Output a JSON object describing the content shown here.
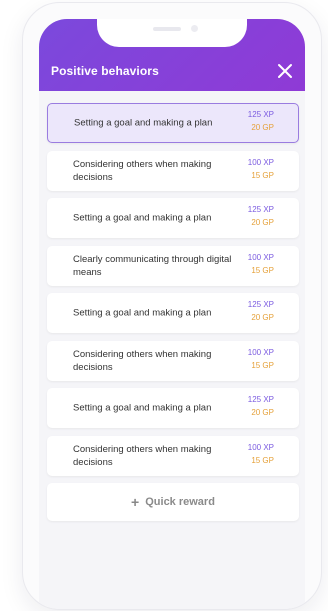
{
  "header": {
    "title": "Positive behaviors",
    "close_icon": "close-icon",
    "accent_color": "#7b49dc"
  },
  "behaviors": [
    {
      "label": "Setting a goal and making a plan",
      "xp": "125 XP",
      "gp": "20 GP",
      "selected": true
    },
    {
      "label": "Considering others when making decisions",
      "xp": "100 XP",
      "gp": "15 GP",
      "selected": false
    },
    {
      "label": "Setting a goal and making a plan",
      "xp": "125 XP",
      "gp": "20 GP",
      "selected": false
    },
    {
      "label": "Clearly communicating through digital means",
      "xp": "100 XP",
      "gp": "15 GP",
      "selected": false
    },
    {
      "label": "Setting a goal and making a plan",
      "xp": "125 XP",
      "gp": "20 GP",
      "selected": false
    },
    {
      "label": "Considering others when making decisions",
      "xp": "100 XP",
      "gp": "15 GP",
      "selected": false
    },
    {
      "label": "Setting a goal and making a plan",
      "xp": "125 XP",
      "gp": "20 GP",
      "selected": false
    },
    {
      "label": "Considering others when making decisions",
      "xp": "100 XP",
      "gp": "15 GP",
      "selected": false
    }
  ],
  "quick_reward": {
    "icon": "plus-icon",
    "label": "Quick reward"
  },
  "colors": {
    "xp": "#7b5be0",
    "gp": "#e5a13a",
    "selected_bg": "#ece7fb"
  }
}
